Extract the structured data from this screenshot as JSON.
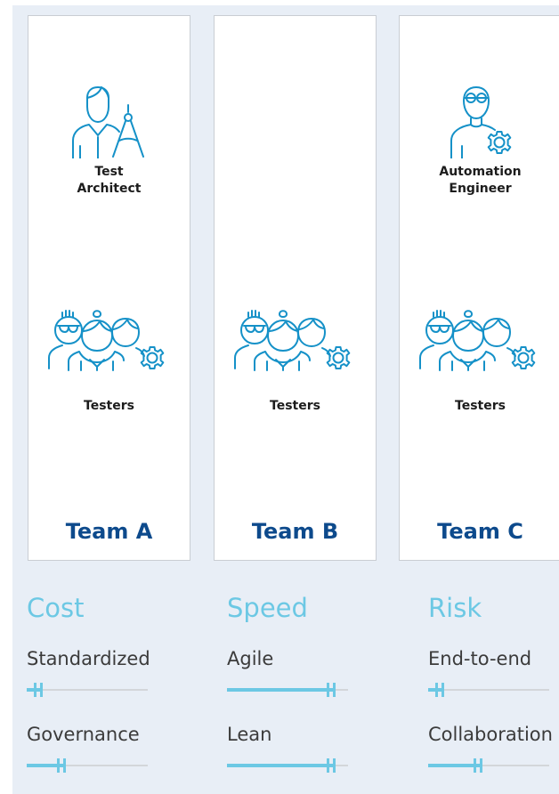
{
  "teams": [
    {
      "name": "Team A",
      "top_role": "Test\nArchitect",
      "top_icon": "architect-icon",
      "group_role": "Testers",
      "group_icon": "testers-group-icon"
    },
    {
      "name": "Team B",
      "top_role": "",
      "top_icon": "",
      "group_role": "Testers",
      "group_icon": "testers-group-icon"
    },
    {
      "name": "Team C",
      "top_role": "Automation\nEngineer",
      "top_icon": "automation-engineer-icon",
      "group_role": "Testers",
      "group_icon": "testers-group-icon"
    }
  ],
  "columns": [
    {
      "category": "Cost",
      "metrics": [
        {
          "label": "Standardized",
          "level": 0.13
        },
        {
          "label": "Governance",
          "level": 0.32
        }
      ]
    },
    {
      "category": "Speed",
      "metrics": [
        {
          "label": "Agile",
          "level": 0.9
        },
        {
          "label": "Lean",
          "level": 0.9
        }
      ]
    },
    {
      "category": "Risk",
      "metrics": [
        {
          "label": "End-to-end",
          "level": 0.13
        },
        {
          "label": "Collaboration",
          "level": 0.45
        }
      ]
    }
  ],
  "colors": {
    "accent": "#6cc8e4",
    "team_label": "#0d4a8c",
    "icon_stroke": "#1591c8",
    "panel": "#e8eef6"
  }
}
